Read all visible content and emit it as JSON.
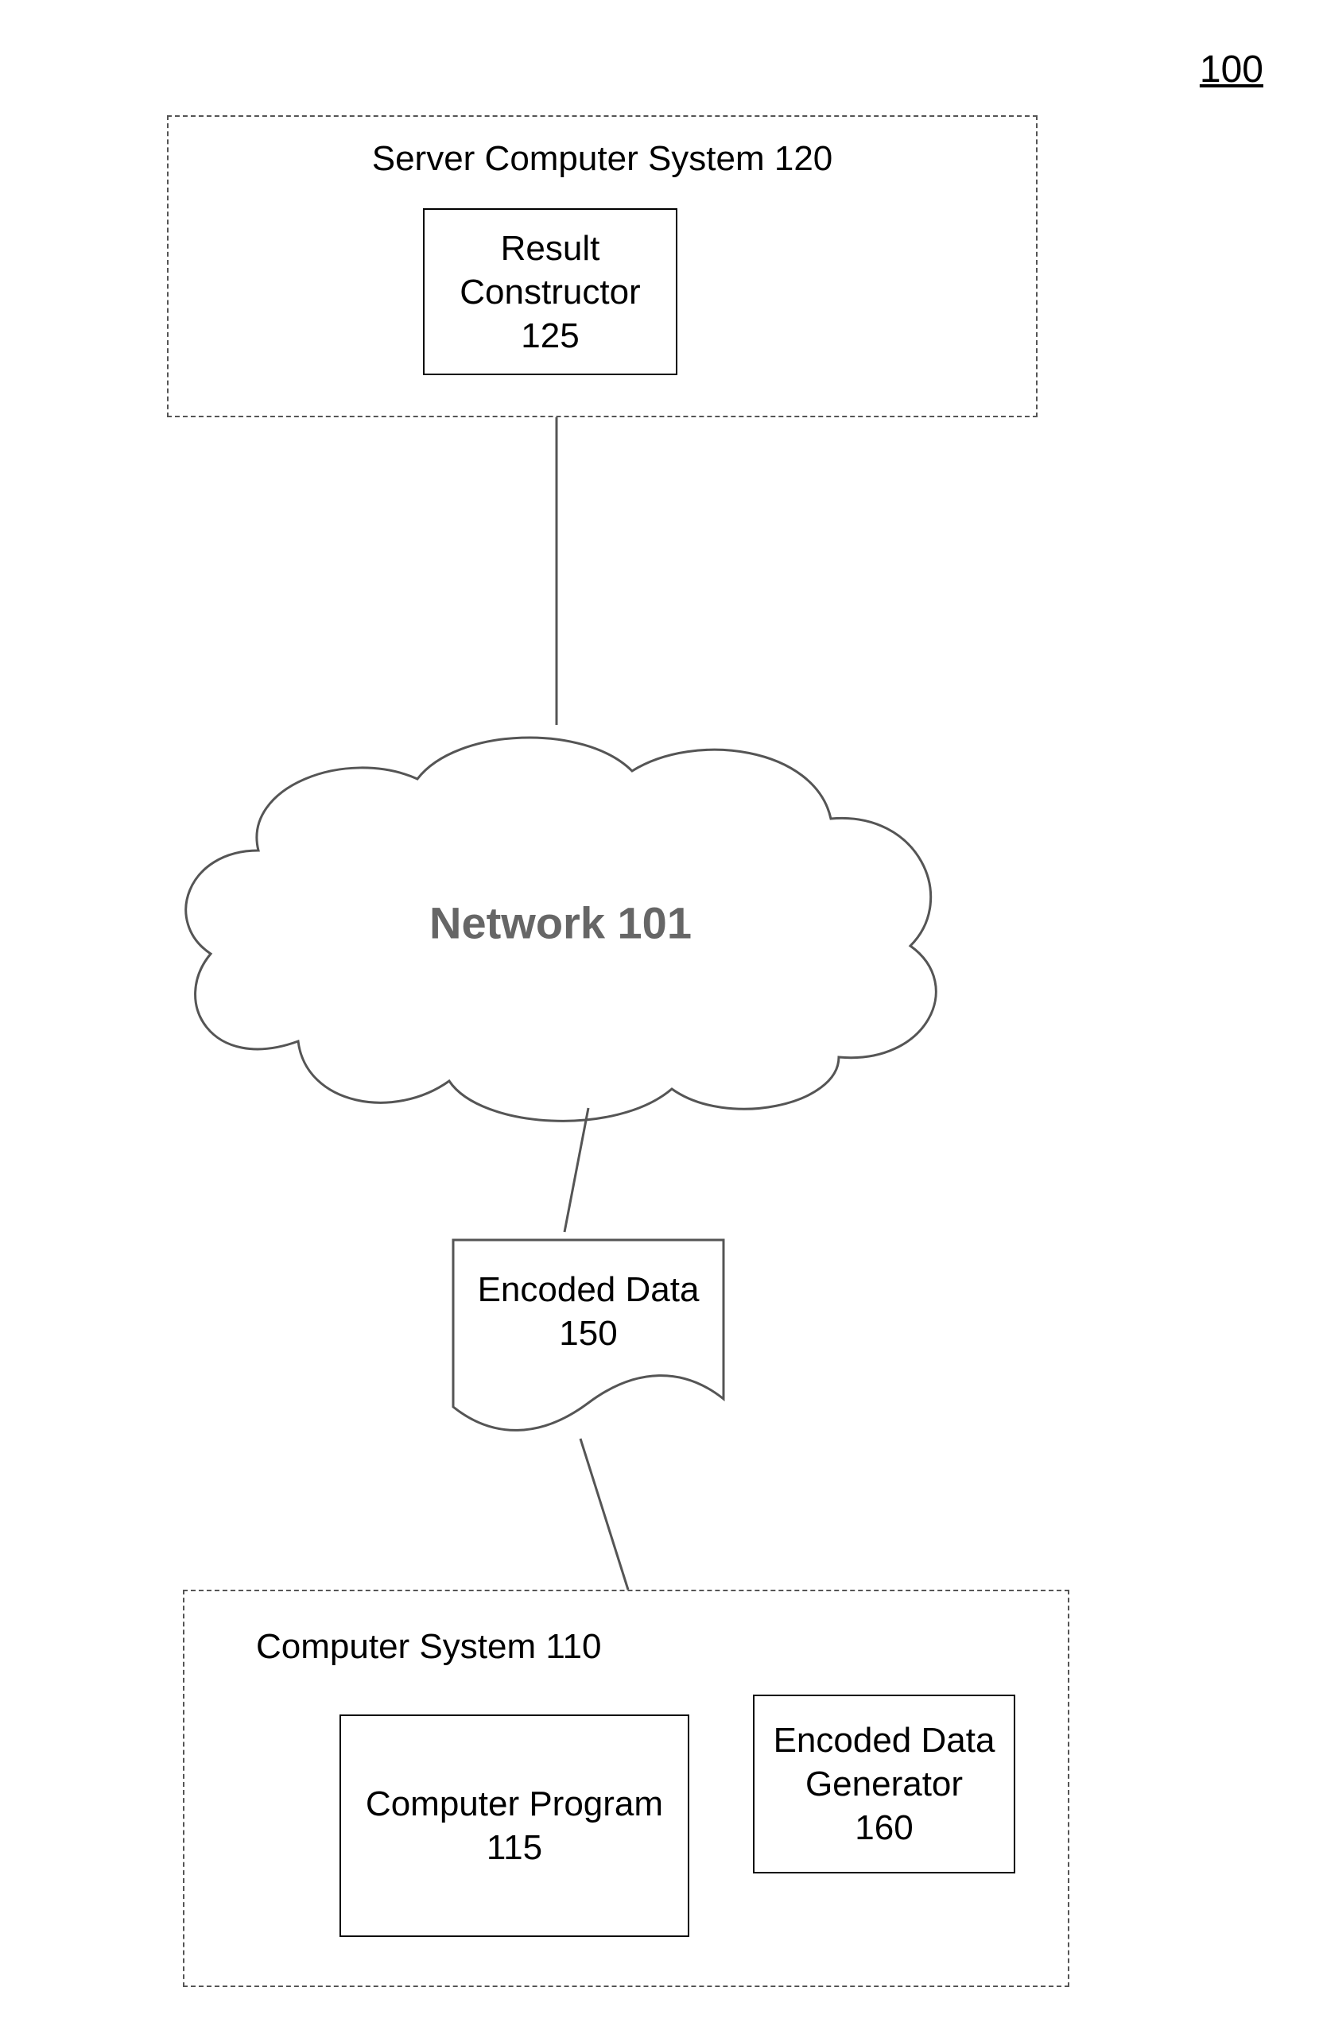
{
  "figure": {
    "number": "100"
  },
  "server": {
    "title": "Server Computer System 120",
    "sub": {
      "line1": "Result",
      "line2": "Constructor",
      "line3": "125"
    }
  },
  "network": {
    "label": "Network 101"
  },
  "encoded_data": {
    "line1": "Encoded Data",
    "line2": "150"
  },
  "client": {
    "title": "Computer System 110",
    "program": {
      "line1": "Computer Program",
      "line2": "115"
    },
    "generator": {
      "line1": "Encoded Data",
      "line2": "Generator",
      "line3": "160"
    }
  }
}
